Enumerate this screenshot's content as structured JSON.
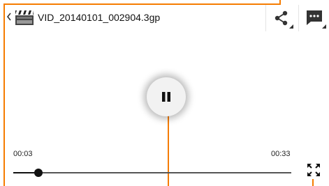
{
  "colors": {
    "accent": "#F57C00",
    "icon_dark": "#333333"
  },
  "header": {
    "back_icon": "chevron-left-icon",
    "app_icon": "video-clapperboard-icon",
    "title": "VID_20140101_002904.3gp",
    "actions": [
      {
        "name": "share",
        "icon": "share-icon"
      },
      {
        "name": "chat",
        "icon": "chat-bubble-icon"
      }
    ]
  },
  "player": {
    "center_icon": "pause-icon",
    "elapsed": "00:03",
    "total": "00:33",
    "progress": 0.09,
    "fullscreen_icon": "fullscreen-icon"
  }
}
